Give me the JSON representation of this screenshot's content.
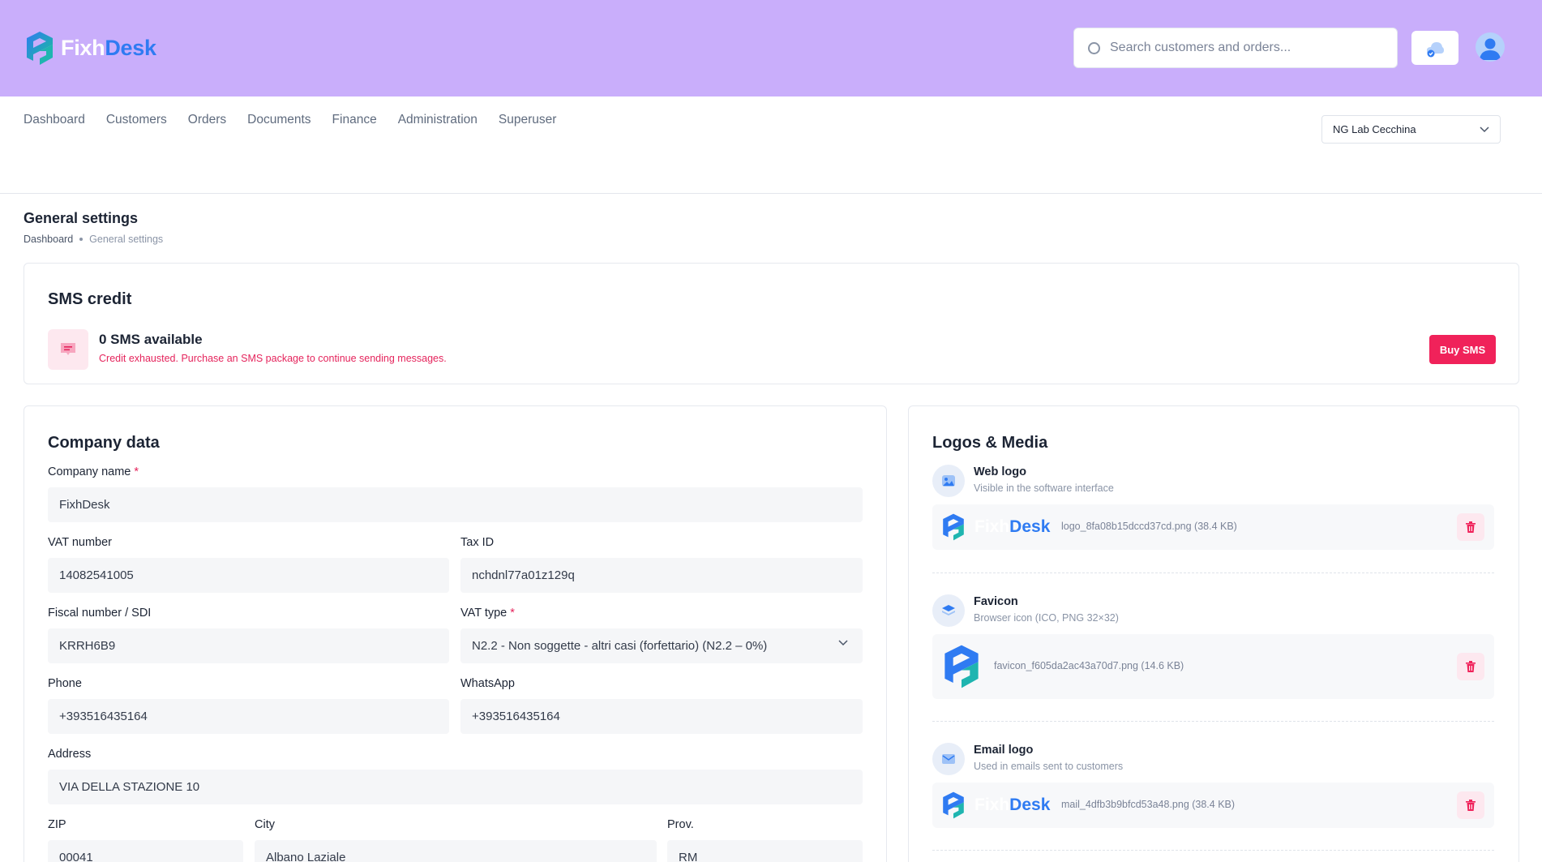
{
  "header": {
    "logo_part1": "Fixh",
    "logo_part2": "Desk",
    "search_placeholder": "Search customers and orders..."
  },
  "nav": {
    "items": [
      "Dashboard",
      "Customers",
      "Orders",
      "Documents",
      "Finance",
      "Administration",
      "Superuser"
    ]
  },
  "branch_select": {
    "value": "NG Lab Cecchina"
  },
  "page": {
    "title": "General settings",
    "breadcrumb": {
      "home": "Dashboard",
      "current": "General settings"
    }
  },
  "sms": {
    "title": "SMS credit",
    "count_label": "0 SMS available",
    "warning": "Credit exhausted. Purchase an SMS package to continue sending messages.",
    "buy_label": "Buy SMS"
  },
  "company": {
    "title": "Company data",
    "required_mark": "*",
    "fields": {
      "company_name": {
        "label": "Company name",
        "value": "FixhDesk"
      },
      "vat_number": {
        "label": "VAT number",
        "value": "14082541005"
      },
      "tax_id": {
        "label": "Tax ID",
        "value": "nchdnl77a01z129q"
      },
      "fiscal_number": {
        "label": "Fiscal number / SDI",
        "value": "KRRH6B9"
      },
      "vat_type": {
        "label": "VAT type",
        "value": "N2.2 - Non soggette - altri casi (forfettario) (N2.2 – 0%)"
      },
      "phone": {
        "label": "Phone",
        "value": "+393516435164"
      },
      "whatsapp": {
        "label": "WhatsApp",
        "value": "+393516435164"
      },
      "address": {
        "label": "Address",
        "value": "VIA DELLA STAZIONE 10"
      },
      "zip": {
        "label": "ZIP",
        "value": "00041"
      },
      "city": {
        "label": "City",
        "value": "Albano Laziale"
      },
      "prov": {
        "label": "Prov.",
        "value": "RM"
      }
    }
  },
  "media": {
    "title": "Logos & Media",
    "web_logo": {
      "title": "Web logo",
      "subtitle": "Visible in the software interface",
      "file": "logo_8fa08b15dccd37cd.png (38.4 KB)",
      "preview_a": "Fixh",
      "preview_b": "Desk"
    },
    "favicon": {
      "title": "Favicon",
      "subtitle": "Browser icon (ICO, PNG 32×32)",
      "file": "favicon_f605da2ac43a70d7.png (14.6 KB)"
    },
    "email_logo": {
      "title": "Email logo",
      "subtitle": "Used in emails sent to customers",
      "file": "mail_4dfb3b9bfcd53a48.png (38.4 KB)",
      "preview_a": "Fixh",
      "preview_b": "Desk"
    }
  },
  "colors": {
    "header_bg": "#c9aefb",
    "brand_blue": "#2f7bf2",
    "danger": "#f0225a"
  }
}
